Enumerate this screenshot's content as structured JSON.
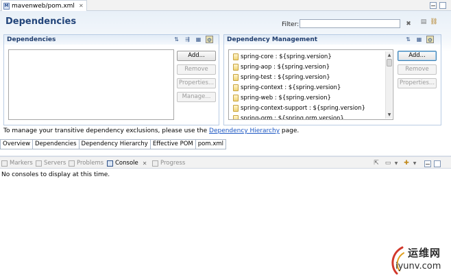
{
  "editor_tab": {
    "title": "mavenweb/pom.xml",
    "icon": "maven-pom-icon"
  },
  "header": {
    "title": "Dependencies",
    "filter_label": "Filter:",
    "filter_value": ""
  },
  "dependencies": {
    "title": "Dependencies",
    "items": [],
    "buttons": {
      "add": "Add...",
      "remove": "Remove",
      "properties": "Properties...",
      "manage": "Manage..."
    }
  },
  "dependency_management": {
    "title": "Dependency Management",
    "items": [
      "spring-core : ${spring.version}",
      "spring-aop : ${spring.version}",
      "spring-test : ${spring.version}",
      "spring-context : ${spring.version}",
      "spring-web : ${spring.version}",
      "spring-context-support : ${spring.version}",
      "spring-orm : ${spring.orm.version}"
    ],
    "buttons": {
      "add": "Add...",
      "remove": "Remove",
      "properties": "Properties..."
    }
  },
  "info": {
    "prefix": "To manage your transitive dependency exclusions, please use the ",
    "link": "Dependency Hierarchy",
    "suffix": " page."
  },
  "page_tabs": [
    "Overview",
    "Dependencies",
    "Dependency Hierarchy",
    "Effective POM",
    "pom.xml"
  ],
  "views": {
    "tabs": [
      "Markers",
      "Servers",
      "Problems",
      "Console",
      "Progress"
    ],
    "active": "Console",
    "console_message": "No consoles to display at this time."
  },
  "watermark": {
    "line1": "运维网",
    "line2": "iyunv.com"
  },
  "colors": {
    "title": "#23457a",
    "link": "#1a55c2",
    "section_border": "#b8cbe3"
  }
}
